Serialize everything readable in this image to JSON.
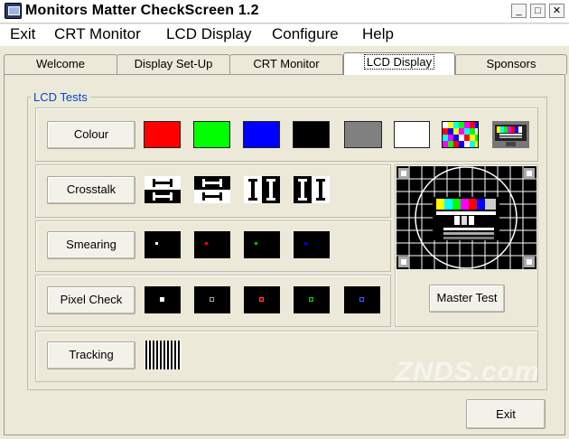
{
  "window": {
    "title": "Monitors Matter CheckScreen 1.2",
    "minimize": "_",
    "maximize": "□",
    "close": "✕"
  },
  "menu": [
    "Exit",
    "CRT Monitor",
    "LCD Display",
    "Configure",
    "Help"
  ],
  "tabs": [
    "Welcome",
    "Display Set-Up",
    "CRT Monitor",
    "LCD Display",
    "Sponsors"
  ],
  "active_tab": "LCD Display",
  "group_label": "LCD Tests",
  "buttons": {
    "colour": "Colour",
    "crosstalk": "Crosstalk",
    "smearing": "Smearing",
    "pixel_check": "Pixel Check",
    "tracking": "Tracking",
    "master_test": "Master Test",
    "exit": "Exit"
  },
  "colour_swatches": [
    "#ff0000",
    "#00ff00",
    "#0000ff",
    "#000000",
    "#808080",
    "#ffffff"
  ],
  "smearing_dot_colors": [
    "#ffffff",
    "#ff0000",
    "#00c000",
    "#0000ff"
  ],
  "pixel_check_colors": [
    "#ffffff",
    "#808080",
    "#ff0000",
    "#00c000",
    "#0000ff"
  ],
  "watermark": "ZNDS.com"
}
